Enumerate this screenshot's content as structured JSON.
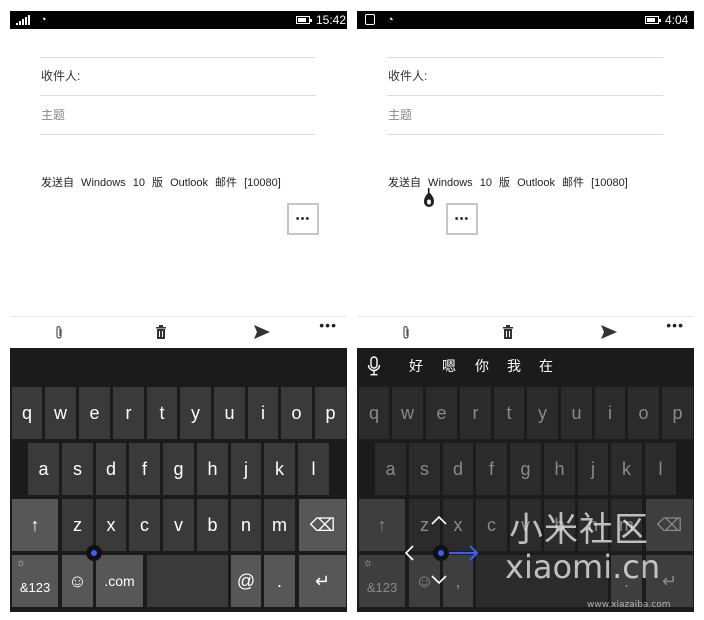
{
  "left_phone": {
    "status": {
      "time": "15:42"
    },
    "compose": {
      "to_label": "收件人:",
      "subject_placeholder": "主题",
      "body_text": "发送自 Windows 10 版 Outlook 邮件 [10080]",
      "more_label": "•••"
    },
    "app_bar": {
      "more_label": "•••"
    },
    "keyboard": {
      "row1": [
        "q",
        "w",
        "e",
        "r",
        "t",
        "y",
        "u",
        "i",
        "o",
        "p"
      ],
      "row2": [
        "a",
        "s",
        "d",
        "f",
        "g",
        "h",
        "j",
        "k",
        "l"
      ],
      "row3": [
        "z",
        "x",
        "c",
        "v",
        "b",
        "n",
        "m"
      ],
      "shift": "↑",
      "backspace": "⌫",
      "numbers_label": "&123",
      "emoji": "☺",
      "dotcom": ".com",
      "at": "@",
      "period": ".",
      "enter": "↵"
    }
  },
  "right_phone": {
    "status": {
      "time": "4:04"
    },
    "compose": {
      "to_label": "收件人:",
      "subject_placeholder": "主题",
      "body_text": "发送自 Windows 10 版 Outlook 邮件 [10080]",
      "more_label": "•••"
    },
    "app_bar": {
      "more_label": "•••"
    },
    "candidates": [
      "好",
      "嗯",
      "你",
      "我",
      "在"
    ],
    "keyboard": {
      "row1": [
        "q",
        "w",
        "e",
        "r",
        "t",
        "y",
        "u",
        "i",
        "o",
        "p"
      ],
      "row2": [
        "a",
        "s",
        "d",
        "f",
        "g",
        "h",
        "j",
        "k",
        "l"
      ],
      "row3": [
        "z",
        "x",
        "c",
        "v",
        "b",
        "n",
        "m"
      ],
      "shift": "↑",
      "backspace": "⌫",
      "numbers_label": "&123",
      "emoji": "☺",
      "comma": ",",
      "period": ".",
      "enter": "↵"
    }
  },
  "watermark": {
    "cn": "小米社区",
    "en": "xiaomi.cn",
    "site": "www.xiazaiba.com"
  },
  "colors": {
    "accent": "#3a5ff5",
    "keyboard_bg": "#1b1b1b",
    "key_bg": "#3a3a3a",
    "fn_key_bg": "#575757"
  }
}
